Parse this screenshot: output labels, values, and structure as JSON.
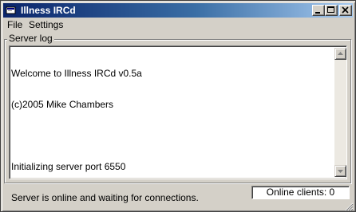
{
  "window": {
    "title": "Illness IRCd",
    "icon": "app-icon",
    "controls": [
      "minimize-icon",
      "maximize-icon",
      "close-icon"
    ]
  },
  "menu": {
    "items": [
      {
        "label": "File"
      },
      {
        "label": "Settings"
      }
    ]
  },
  "server_log": {
    "label": "Server log",
    "lines": [
      "Welcome to Illness IRCd v0.5a",
      "(c)2005 Mike Chambers",
      "",
      "Initializing server port 6550",
      "Server is online and waiting for connections."
    ]
  },
  "status": {
    "online_clients": "Online clients: 0"
  },
  "colors": {
    "title_gradient_start": "#0a246a",
    "title_gradient_end": "#a6caf0",
    "window_face": "#d4d0c8"
  }
}
